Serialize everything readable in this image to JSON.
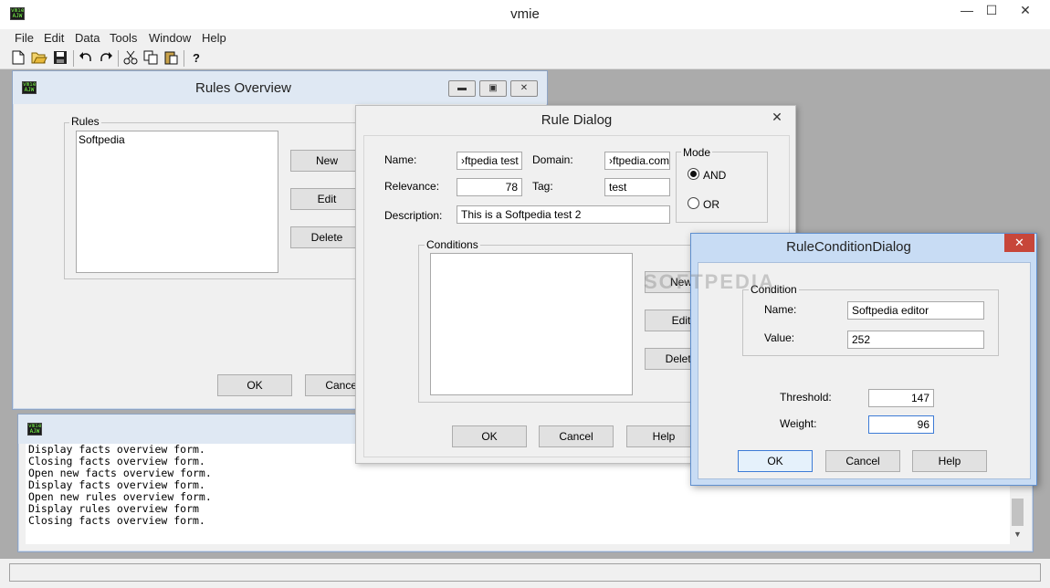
{
  "app": {
    "title": "vmie",
    "icon_text": "vmie AJW"
  },
  "window_controls": {
    "minimize": "—",
    "maximize": "☐",
    "close": "✕"
  },
  "menu": [
    "File",
    "Edit",
    "Data",
    "Tools",
    "Window",
    "Help"
  ],
  "toolbar": [
    "new-doc-icon",
    "open-folder-icon",
    "save-icon",
    "undo-icon",
    "redo-icon",
    "cut-icon",
    "copy-icon",
    "paste-icon",
    "help-icon"
  ],
  "rules_overview": {
    "title": "Rules Overview",
    "group_label": "Rules",
    "rules": [
      "Softpedia"
    ],
    "new_label": "New",
    "edit_label": "Edit",
    "delete_label": "Delete",
    "ok_label": "OK",
    "cancel_label": "Cancel"
  },
  "rule_dialog": {
    "title": "Rule Dialog",
    "name_label": "Name:",
    "name_value": "›ftpedia test",
    "domain_label": "Domain:",
    "domain_value": "›ftpedia.com",
    "relevance_label": "Relevance:",
    "relevance_value": "78",
    "tag_label": "Tag:",
    "tag_value": "test",
    "description_label": "Description:",
    "description_value": "This is a Softpedia test 2",
    "mode_label": "Mode",
    "mode_and": "AND",
    "mode_or": "OR",
    "mode_selected": "AND",
    "conditions_label": "Conditions",
    "new_label": "New",
    "edit_label": "Edit",
    "delete_label": "Delete",
    "ok_label": "OK",
    "cancel_label": "Cancel",
    "help_label": "Help"
  },
  "condition_dialog": {
    "title": "RuleConditionDialog",
    "group_label": "Condition",
    "name_label": "Name:",
    "name_value": "Softpedia editor",
    "value_label": "Value:",
    "value_value": "252",
    "threshold_label": "Threshold:",
    "threshold_value": "147",
    "weight_label": "Weight:",
    "weight_value": "96",
    "ok_label": "OK",
    "cancel_label": "Cancel",
    "help_label": "Help"
  },
  "log": {
    "lines": [
      "Display facts overview form.",
      "Closing facts overview form.",
      "Open new facts overview form.",
      "Display facts overview form.",
      "Open new rules overview form.",
      "Display rules overview form",
      "Closing facts overview form."
    ]
  },
  "watermark": "SOFTPEDIA",
  "colors": {
    "mdi_background": "#ababab",
    "active_title": "#c8dcf4",
    "close_red": "#c7463a",
    "focus_border": "#3d7bd6"
  }
}
